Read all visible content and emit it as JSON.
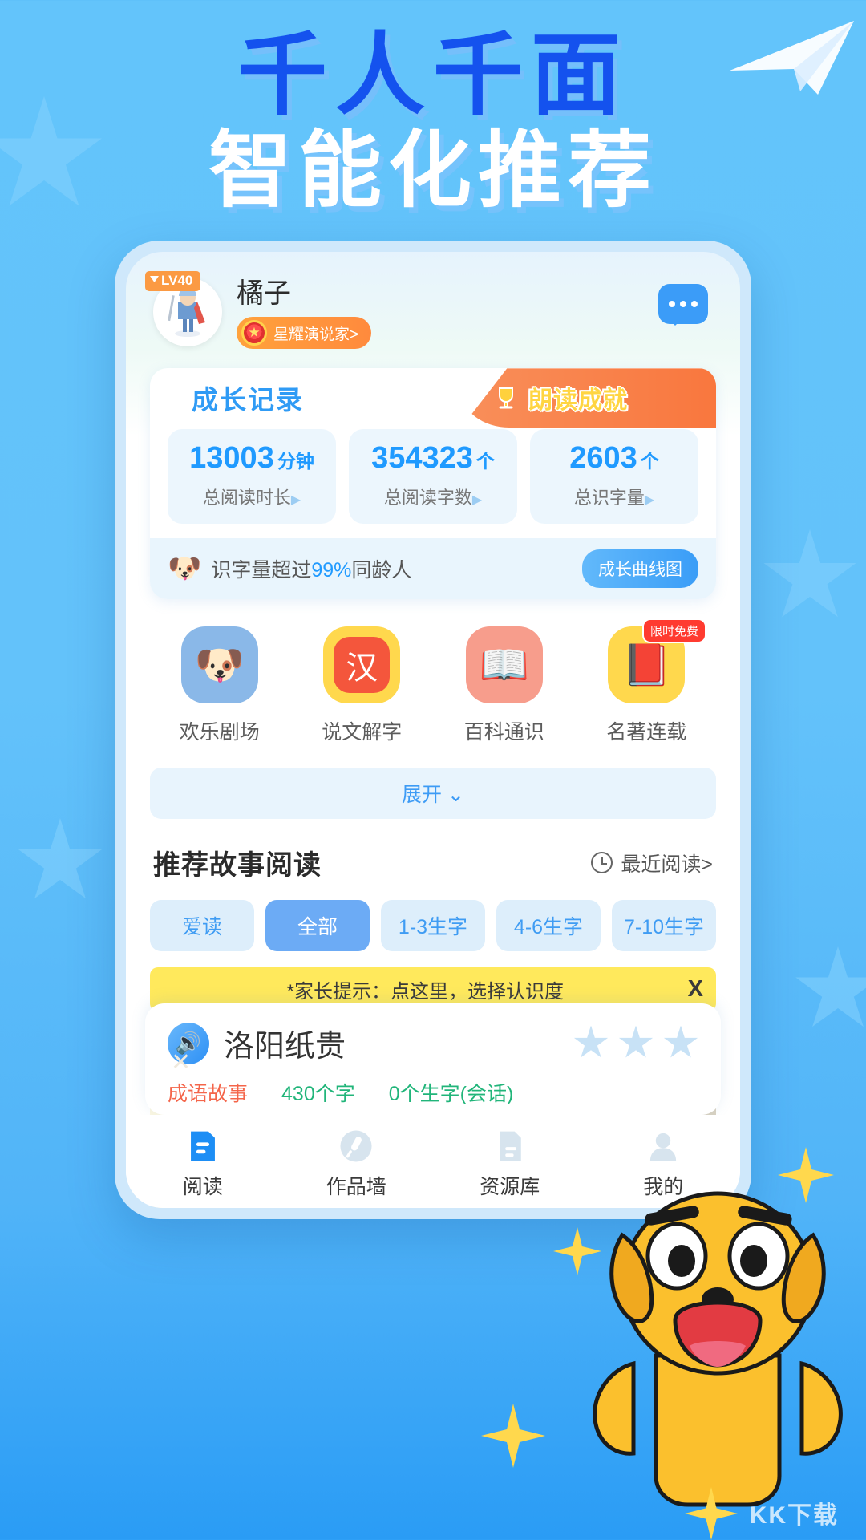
{
  "headline": {
    "line1": "千人千面",
    "line2": "智能化推荐"
  },
  "profile": {
    "level_badge": "LV40",
    "name": "橘子",
    "medal_label": "星耀演说家>",
    "avatar_icon": "knight-avatar",
    "message_icon": "message-bubble-icon"
  },
  "growth": {
    "title": "成长记录",
    "achievement_tab": "朗读成就",
    "trophy_icon": "trophy-icon",
    "stats": [
      {
        "value": "13003",
        "unit": "分钟",
        "label": "总阅读时长",
        "arrow": "▶"
      },
      {
        "value": "354323",
        "unit": "个",
        "label": "总阅读字数",
        "arrow": "▶"
      },
      {
        "value": "2603",
        "unit": "个",
        "label": "总识字量",
        "arrow": "▶"
      }
    ],
    "footer_prefix": "识字量超过",
    "footer_highlight": "99%",
    "footer_suffix": "同龄人",
    "curve_button": "成长曲线图",
    "dog_icon": "dog-face-icon"
  },
  "grid": [
    {
      "label": "欢乐剧场",
      "icon": "dog-theater-icon",
      "glyph": "🐶",
      "bg": "#8ab8e8",
      "badge": ""
    },
    {
      "label": "说文解字",
      "icon": "han-character-icon",
      "glyph": "汉",
      "bg": "#ffd84d",
      "badge": ""
    },
    {
      "label": "百科通识",
      "icon": "open-book-icon",
      "glyph": "📖",
      "bg": "#f79d8c",
      "badge": ""
    },
    {
      "label": "名著连载",
      "icon": "classic-book-icon",
      "glyph": "📕",
      "bg": "#ffd84d",
      "badge": "限时免费"
    }
  ],
  "expand_label": "展开",
  "expand_icon": "chevron-down-icon",
  "recommend": {
    "title": "推荐故事阅读",
    "recent_label": "最近阅读>",
    "clock_icon": "clock-icon",
    "chips": [
      {
        "label": "爱读",
        "active": false
      },
      {
        "label": "全部",
        "active": true
      },
      {
        "label": "1-3生字",
        "active": false
      },
      {
        "label": "4-6生字",
        "active": false
      },
      {
        "label": "7-10生字",
        "active": false
      }
    ],
    "tip": "*家长提示：点这里，选择认识度",
    "tip_close": "X"
  },
  "story": {
    "close_icon": "close-icon",
    "title": "洛阳纸贵",
    "speaker_icon": "speaker-icon",
    "star_icon": "star-icon",
    "star_count": 3,
    "meta": [
      {
        "text": "成语故事",
        "color": "#f4654a"
      },
      {
        "text": "430个字",
        "color": "#21b57a"
      },
      {
        "text": "0个生字(会话)",
        "color": "#21b57a"
      }
    ]
  },
  "nav": [
    {
      "label": "阅读",
      "icon": "book-icon",
      "active": true
    },
    {
      "label": "作品墙",
      "icon": "microphone-icon",
      "active": false
    },
    {
      "label": "资源库",
      "icon": "library-icon",
      "active": false
    },
    {
      "label": "我的",
      "icon": "profile-icon",
      "active": false
    }
  ],
  "watermark": "KK下载",
  "colors": {
    "bg_top": "#63c4fb",
    "bg_bottom": "#2a9cf5",
    "headline_blue": "#1452ee",
    "accent_blue": "#1f9aff",
    "accent_orange": "#f9773e",
    "tip_yellow": "#ffe95c",
    "mascot_yellow": "#fbc02d"
  }
}
